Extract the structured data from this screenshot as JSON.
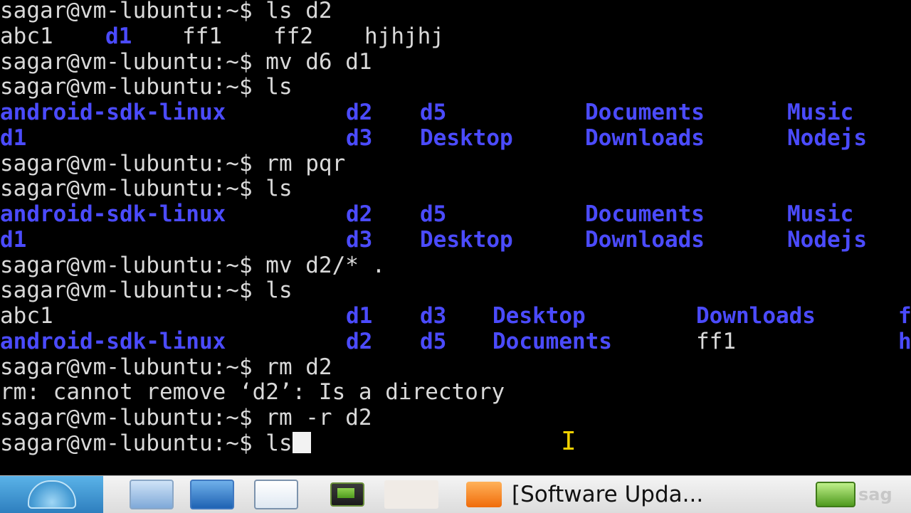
{
  "terminal": {
    "lines": [
      {
        "prompt": "sagar@vm-lubuntu:~$ ",
        "command": "ls d2"
      },
      {
        "entries": [
          "abc1",
          "d1",
          "ff1",
          "ff2",
          "hjhjhj"
        ]
      },
      {
        "prompt": "sagar@vm-lubuntu:~$ ",
        "command": "mv d6 d1"
      },
      {
        "prompt": "sagar@vm-lubuntu:~$ ",
        "command": "ls"
      },
      {
        "entries": [
          "android-sdk-linux",
          "d2",
          "d5",
          "Documents",
          "Music"
        ]
      },
      {
        "entries": [
          "d1",
          "d3",
          "Desktop",
          "Downloads",
          "Nodejs"
        ]
      },
      {
        "prompt": "sagar@vm-lubuntu:~$ ",
        "command": "rm pqr"
      },
      {
        "prompt": "sagar@vm-lubuntu:~$ ",
        "command": "ls"
      },
      {
        "entries": [
          "android-sdk-linux",
          "d2",
          "d5",
          "Documents",
          "Music"
        ]
      },
      {
        "entries": [
          "d1",
          "d3",
          "Desktop",
          "Downloads",
          "Nodejs"
        ]
      },
      {
        "prompt": "sagar@vm-lubuntu:~$ ",
        "command": "mv d2/* ."
      },
      {
        "prompt": "sagar@vm-lubuntu:~$ ",
        "command": "ls"
      },
      {
        "entries": [
          "abc1",
          "d1",
          "d3",
          "Desktop",
          "Downloads",
          "f"
        ]
      },
      {
        "entries": [
          "android-sdk-linux",
          "d2",
          "d5",
          "Documents",
          "ff1",
          "h"
        ]
      },
      {
        "prompt": "sagar@vm-lubuntu:~$ ",
        "command": "rm d2"
      },
      {
        "output": "rm: cannot remove ‘d2’: Is a directory"
      },
      {
        "prompt": "sagar@vm-lubuntu:~$ ",
        "command": "rm -r d2"
      },
      {
        "prompt": "sagar@vm-lubuntu:~$ ",
        "command": "ls"
      }
    ]
  },
  "taskbar": {
    "start_icon": "lubuntu-start-icon",
    "launchers": [
      "file-manager-icon",
      "network-icon",
      "window-icon",
      "terminal-icon"
    ],
    "active_task_label": "[Software Upda...",
    "tray_text": "sag",
    "tray_icon": "terminal-icon"
  },
  "colors": {
    "terminal_bg": "#000000",
    "terminal_fg": "#d9d9d9",
    "directory": "#4b4bff",
    "ibeam_cursor": "#f0d000"
  }
}
